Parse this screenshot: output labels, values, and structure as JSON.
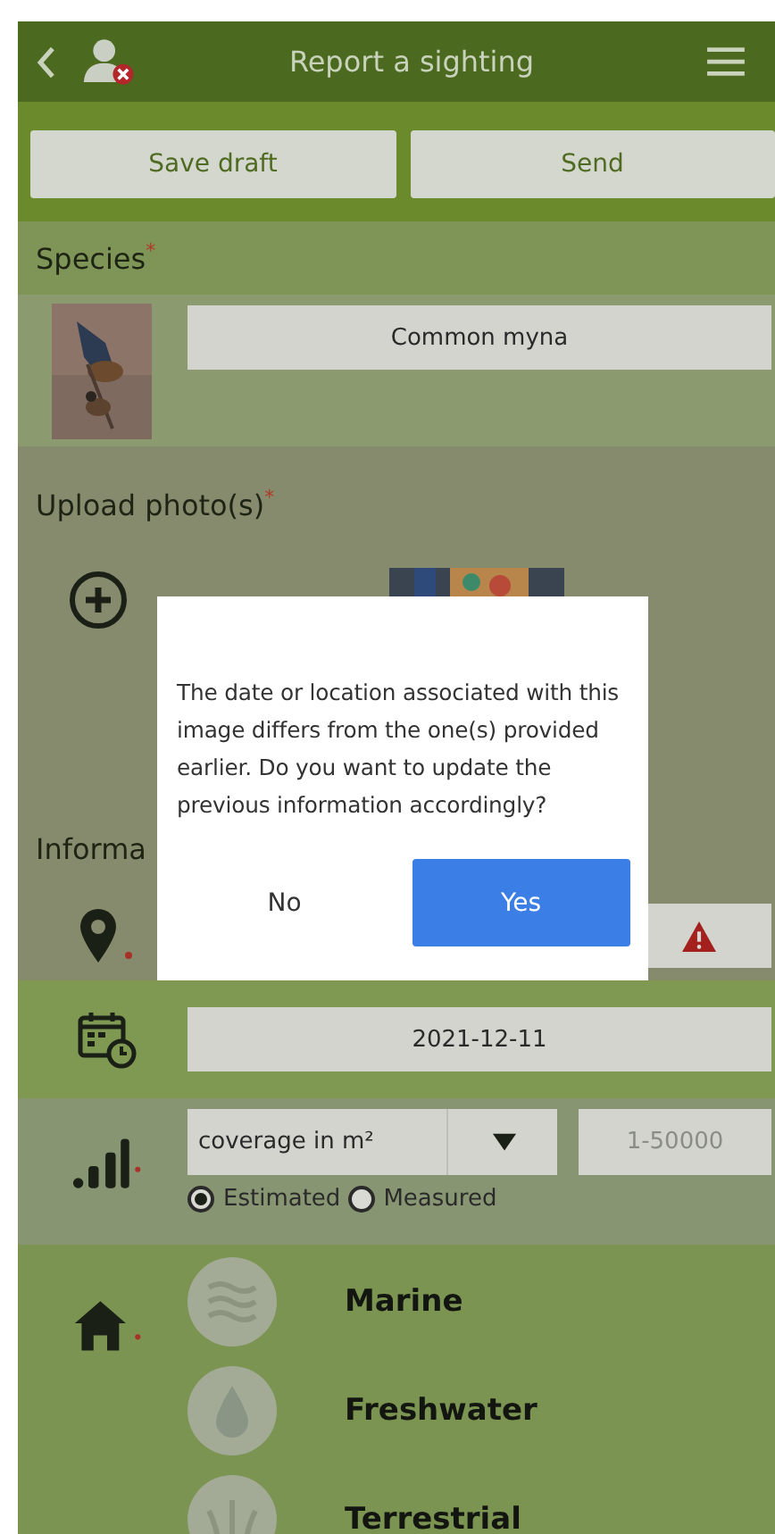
{
  "header": {
    "title": "Report a sighting"
  },
  "actions": [
    "Save draft",
    "Send"
  ],
  "species": {
    "label": "Species",
    "required_mark": "*",
    "value": "Common myna"
  },
  "upload": {
    "label": "Upload photo(s)",
    "required_mark": "*"
  },
  "information": {
    "label": "Informa",
    "location": {
      "warning": true
    },
    "date": "2021-12-11",
    "coverage": {
      "unit": "coverage in m²",
      "placeholder": "1-50000",
      "methods": [
        {
          "label": "Estimated",
          "selected": true
        },
        {
          "label": "Measured",
          "selected": false
        }
      ]
    },
    "habitats": [
      {
        "kind": "marine",
        "label": "Marine"
      },
      {
        "kind": "freshwater",
        "label": "Freshwater"
      },
      {
        "kind": "terrestrial",
        "label": "Terrestrial"
      }
    ]
  },
  "dialog": {
    "message": "The date or location associated with this image differs from the one(s) provided earlier. Do you want to update the previous information accordingly?",
    "buttons": [
      {
        "label": "No",
        "primary": false
      },
      {
        "label": "Yes",
        "primary": true
      }
    ]
  }
}
